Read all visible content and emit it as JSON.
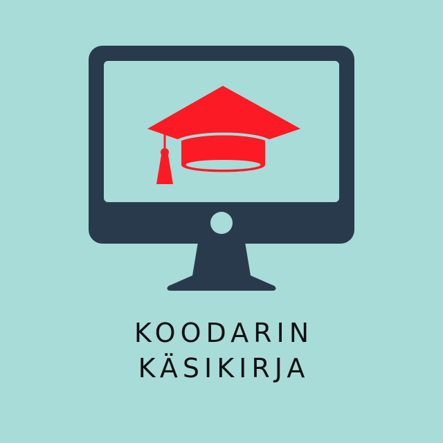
{
  "logo": {
    "title_line_1": "KOODARIN",
    "title_line_2": "KÄSIKIRJA"
  },
  "icons": {
    "monitor": "monitor-icon",
    "graduation_cap": "graduation-cap-icon"
  },
  "colors": {
    "background": "#a8dcd9",
    "monitor": "#2a3a4d",
    "cap": "#fc1a24",
    "text": "#111111"
  }
}
